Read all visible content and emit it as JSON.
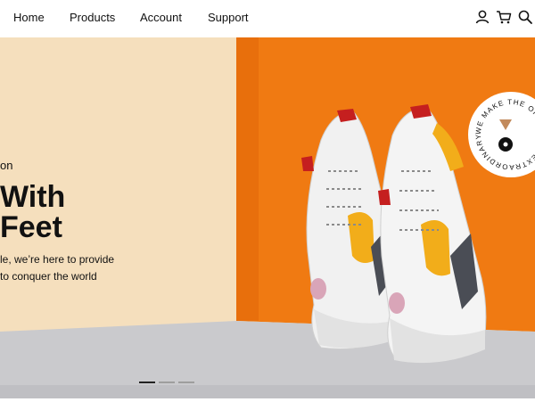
{
  "nav": {
    "links": [
      "Home",
      "Products",
      "Account",
      "Support"
    ],
    "icons": [
      "user-icon",
      "cart-icon",
      "search-icon"
    ]
  },
  "hero": {
    "eyebrow": "on",
    "headline_line1": "With",
    "headline_line2": "Feet",
    "desc_line1": "le, we’re here to provide",
    "desc_line2": "to conquer the world",
    "badge_text": "WE MAKE THE ORDINARY, EXTRAORDINARY.",
    "carousel": {
      "slide_count": 3,
      "active_index": 0
    }
  },
  "colors": {
    "accent_orange": "#f07a12",
    "cream": "#f4dfbe",
    "floor": "#c9c9cc",
    "text": "#111111"
  }
}
